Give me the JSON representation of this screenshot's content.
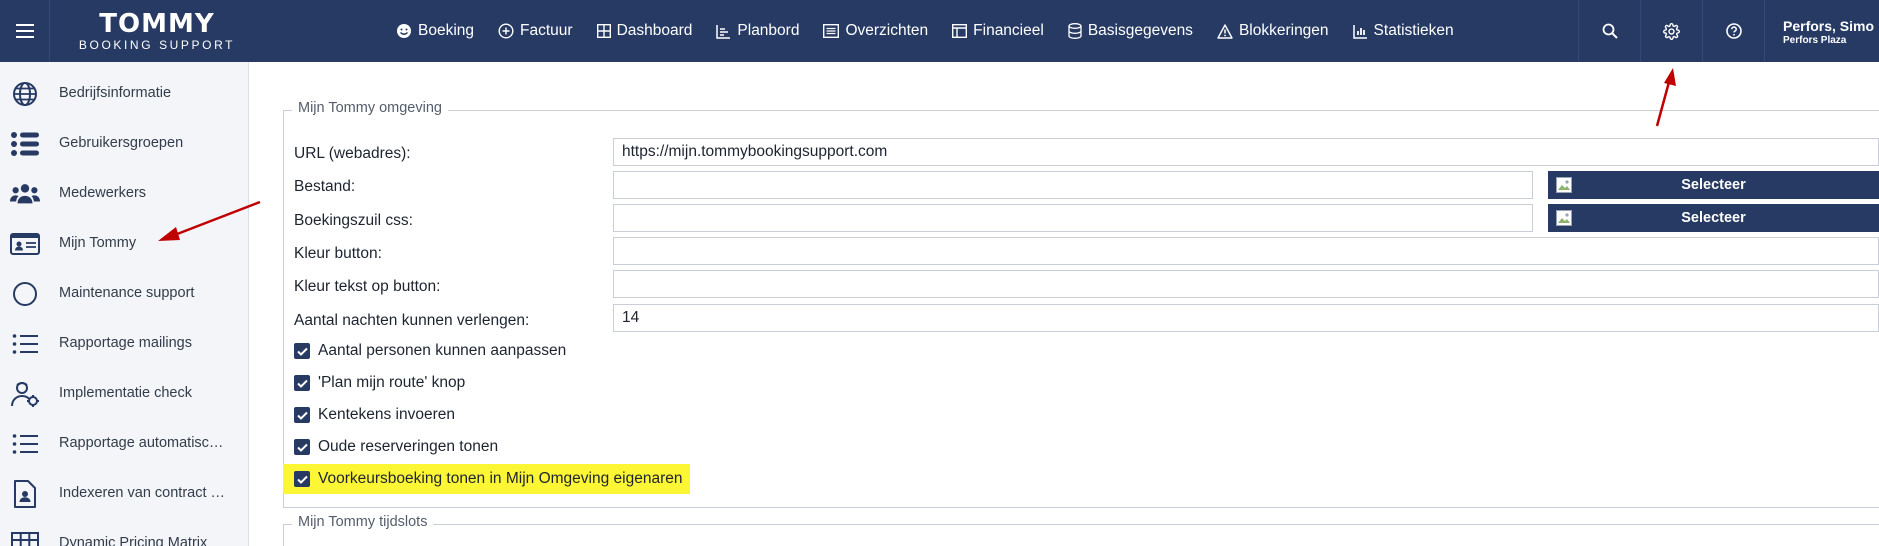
{
  "app": {
    "logo_title": "TOMMY",
    "logo_subtitle": "BOOKING SUPPORT"
  },
  "topbar": {
    "nav": [
      {
        "label": "Boeking",
        "icon": "smiley-icon"
      },
      {
        "label": "Factuur",
        "icon": "plus-circle-icon"
      },
      {
        "label": "Dashboard",
        "icon": "grid-icon"
      },
      {
        "label": "Planbord",
        "icon": "chart-icon"
      },
      {
        "label": "Overzichten",
        "icon": "list-box-icon"
      },
      {
        "label": "Financieel",
        "icon": "table-icon"
      },
      {
        "label": "Basisgegevens",
        "icon": "database-icon"
      },
      {
        "label": "Blokkeringen",
        "icon": "warning-icon"
      },
      {
        "label": "Statistieken",
        "icon": "bar-chart-icon"
      }
    ],
    "user_name": "Perfors, Simo",
    "user_company": "Perfors Plaza"
  },
  "sidebar": {
    "items": [
      {
        "label": "Bedrijfsinformatie",
        "icon": "globe-icon"
      },
      {
        "label": "Gebruikersgroepen",
        "icon": "toggles-icon"
      },
      {
        "label": "Medewerkers",
        "icon": "users-icon"
      },
      {
        "label": "Mijn Tommy",
        "icon": "id-card-icon"
      },
      {
        "label": "Maintenance support",
        "icon": "circle-icon"
      },
      {
        "label": "Rapportage mailings",
        "icon": "list-icon"
      },
      {
        "label": "Implementatie check",
        "icon": "user-gear-icon"
      },
      {
        "label": "Rapportage automatisc…",
        "icon": "list-icon"
      },
      {
        "label": "Indexeren van contract …",
        "icon": "file-user-icon"
      },
      {
        "label": "Dynamic Pricing Matrix",
        "icon": "grid-table-icon"
      }
    ]
  },
  "form": {
    "section_title": "Mijn Tommy omgeving",
    "url_label": "URL (webadres):",
    "url_value": "https://mijn.tommybookingsupport.com",
    "file_label": "Bestand:",
    "file_value": "",
    "css_label": "Boekingszuil css:",
    "css_value": "",
    "select_label": "Selecteer",
    "button_color_label": "Kleur button:",
    "button_color_value": "",
    "button_text_color_label": "Kleur tekst op button:",
    "button_text_color_value": "",
    "nights_label": "Aantal nachten kunnen verlengen:",
    "nights_value": "14",
    "checkboxes": [
      {
        "label": "Aantal personen kunnen aanpassen",
        "checked": true
      },
      {
        "label": "'Plan mijn route' knop",
        "checked": true
      },
      {
        "label": "Kentekens invoeren",
        "checked": true
      },
      {
        "label": "Oude reserveringen tonen",
        "checked": true
      },
      {
        "label": "Voorkeursboeking tonen in Mijn Omgeving eigenaren",
        "checked": true
      }
    ],
    "section2_title": "Mijn Tommy tijdslots"
  },
  "colors": {
    "topbar": "#263a63",
    "highlight": "#fdf635",
    "annotation_arrow": "#c00000"
  }
}
